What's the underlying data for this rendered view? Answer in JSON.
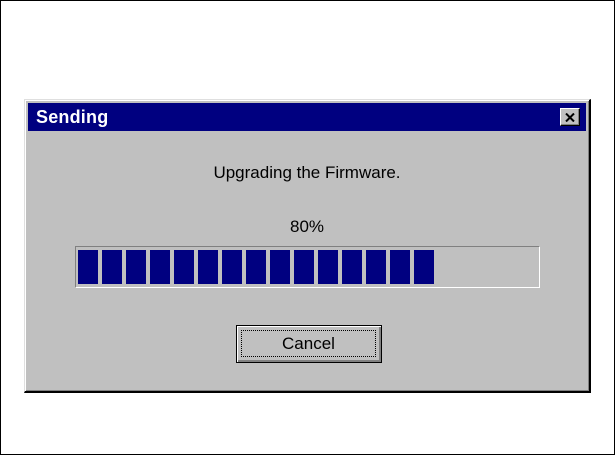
{
  "dialog": {
    "title": "Sending",
    "close_icon": "close-icon",
    "message": "Upgrading the Firmware.",
    "progress_label": "80%",
    "progress_fraction": 0.8,
    "cancel_label": "Cancel"
  },
  "colors": {
    "titlebar": "#000080",
    "face": "#c0c0c0",
    "progress_block": "#000080"
  }
}
